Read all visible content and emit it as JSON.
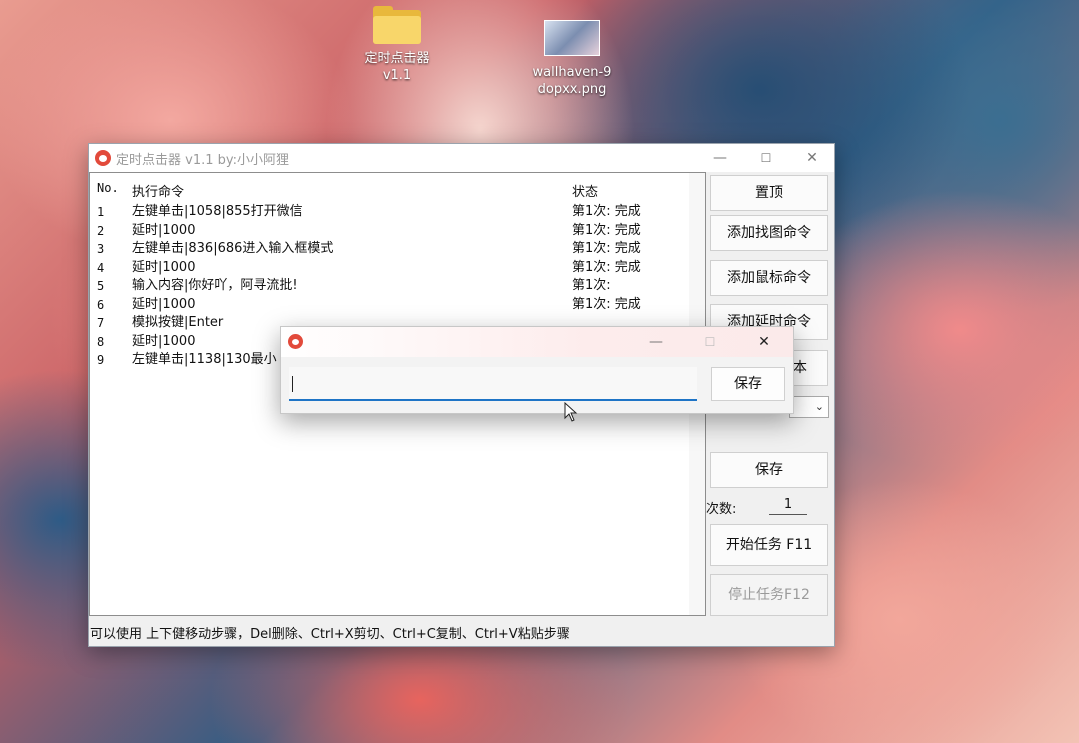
{
  "desktop": {
    "icons": [
      {
        "label_line1": "定时点击器",
        "label_line2": "v1.1"
      },
      {
        "label_line1": "wallhaven-9",
        "label_line2": "dopxx.png"
      }
    ]
  },
  "window": {
    "title": "定时点击器 v1.1 by:小小阿狸",
    "controls": {
      "minimize": "—",
      "maximize": "☐",
      "close": "✕"
    },
    "table": {
      "headers": {
        "no": "No.",
        "command": "执行命令",
        "status": "状态"
      },
      "rows": [
        {
          "no": "1",
          "command": "左键单击|1058|855打开微信",
          "status": "第1次: 完成"
        },
        {
          "no": "2",
          "command": "延时|1000",
          "status": "第1次: 完成"
        },
        {
          "no": "3",
          "command": "左键单击|836|686进入输入框模式",
          "status": "第1次: 完成"
        },
        {
          "no": "4",
          "command": "延时|1000",
          "status": "第1次: 完成"
        },
        {
          "no": "5",
          "command": "输入内容|你好吖，阿寻流批!",
          "status": "第1次:"
        },
        {
          "no": "6",
          "command": "延时|1000",
          "status": "第1次: 完成"
        },
        {
          "no": "7",
          "command": "模拟按键|Enter",
          "status": ""
        },
        {
          "no": "8",
          "command": "延时|1000",
          "status": ""
        },
        {
          "no": "9",
          "command": "左键单击|1138|130最小",
          "status": ""
        }
      ]
    },
    "side_buttons": {
      "pin": "置顶",
      "add_find_image": "添加找图命令",
      "add_mouse": "添加鼠标命令",
      "add_delay": "添加延时命令",
      "add_text_partial": "本",
      "save": "保存",
      "start": "开始任务 F11",
      "stop": "停止任务F12"
    },
    "count": {
      "label": "次数:",
      "value": "1"
    },
    "status_bar": "可以使用 上下健移动步骤，Del删除、Ctrl+X剪切、Ctrl+C复制、Ctrl+V粘贴步骤"
  },
  "dialog": {
    "controls": {
      "minimize": "—",
      "maximize": "☐",
      "close": "✕"
    },
    "input_value": "",
    "save_label": "保存"
  }
}
